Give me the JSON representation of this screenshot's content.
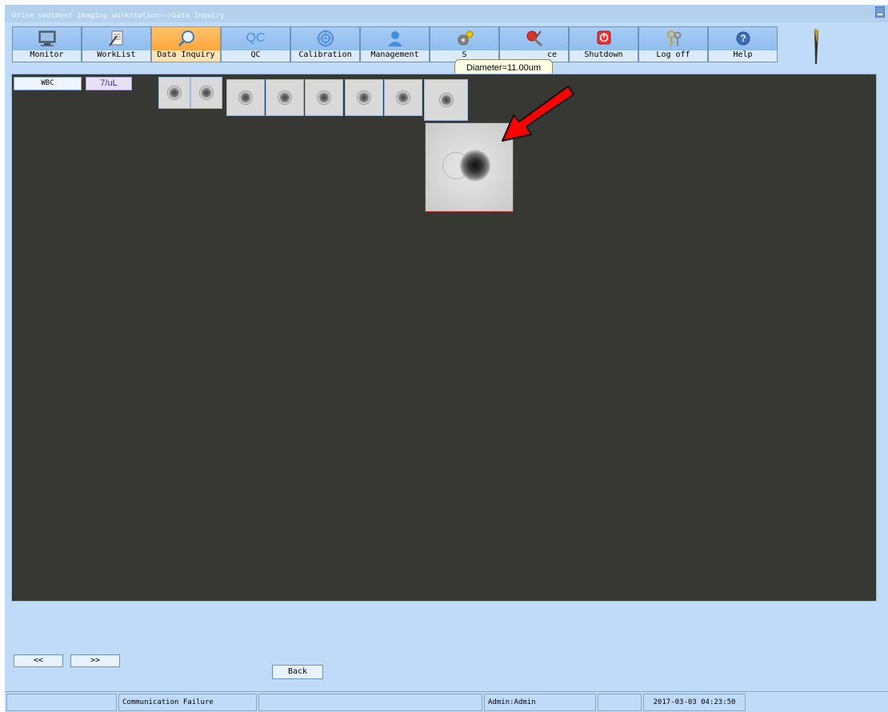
{
  "window": {
    "title": "Urine sediment imaging workstation-->Data Inquiry"
  },
  "toolbar": {
    "buttons": [
      {
        "label": "Monitor",
        "icon": "monitor-icon"
      },
      {
        "label": "WorkList",
        "icon": "worklist-icon"
      },
      {
        "label": "Data Inquiry",
        "icon": "search-icon",
        "active": true
      },
      {
        "label": "QC",
        "icon": "qc-icon",
        "icon_text": "QC"
      },
      {
        "label": "Calibration",
        "icon": "target-icon"
      },
      {
        "label": "Management",
        "icon": "user-icon"
      },
      {
        "label": "S",
        "icon": "gear-icon"
      },
      {
        "label": "ce",
        "icon": "tools-icon"
      },
      {
        "label": "Shutdown",
        "icon": "power-icon"
      },
      {
        "label": "Log off",
        "icon": "keys-icon"
      },
      {
        "label": "Help",
        "icon": "help-icon"
      }
    ]
  },
  "tooltip": {
    "text": "Diameter=11.00um"
  },
  "panel": {
    "category_label": "WBC",
    "count_label": "7/uL",
    "thumbnail_count": 8
  },
  "pagination": {
    "prev_label": "<<",
    "next_label": ">>"
  },
  "back_label": "Back",
  "statusbar": {
    "communication": "Communication Failure",
    "user": "Admin:Admin",
    "datetime": "2017-03-03 04:23:50"
  },
  "colors": {
    "accent": "#ffa63a",
    "panel_bg": "#373834",
    "app_bg": "#bfdbf7",
    "arrow": "#ff0000"
  }
}
